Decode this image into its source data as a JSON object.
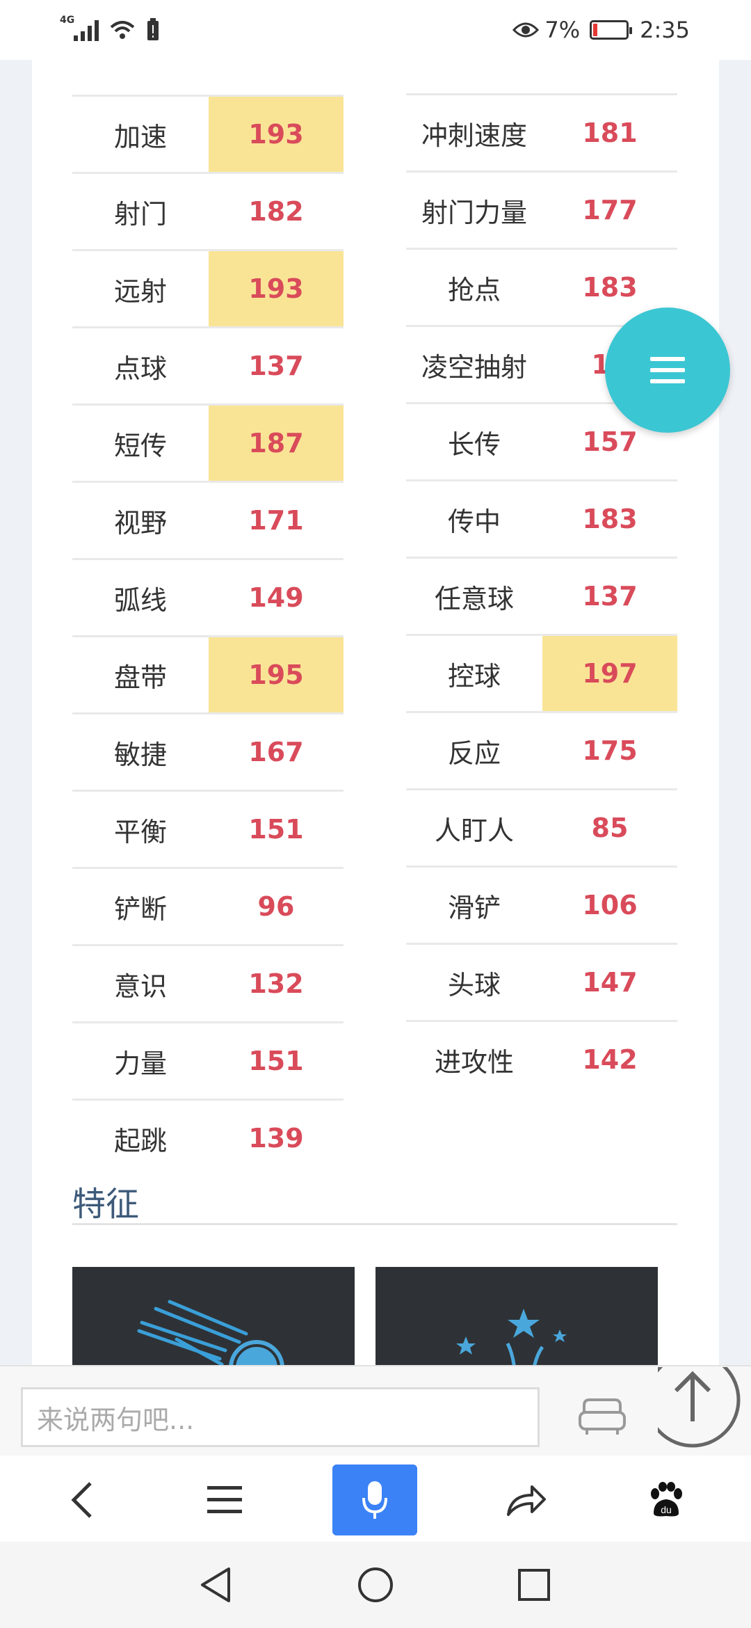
{
  "status_bar": {
    "network": "4G",
    "battery_percent": "7%",
    "time": "2:35"
  },
  "stats_left": [
    {
      "name": "加速",
      "value": "193",
      "highlight": true
    },
    {
      "name": "射门",
      "value": "182",
      "highlight": false
    },
    {
      "name": "远射",
      "value": "193",
      "highlight": true
    },
    {
      "name": "点球",
      "value": "137",
      "highlight": false
    },
    {
      "name": "短传",
      "value": "187",
      "highlight": true
    },
    {
      "name": "视野",
      "value": "171",
      "highlight": false
    },
    {
      "name": "弧线",
      "value": "149",
      "highlight": false
    },
    {
      "name": "盘带",
      "value": "195",
      "highlight": true
    },
    {
      "name": "敏捷",
      "value": "167",
      "highlight": false
    },
    {
      "name": "平衡",
      "value": "151",
      "highlight": false
    },
    {
      "name": "铲断",
      "value": "96",
      "highlight": false
    },
    {
      "name": "意识",
      "value": "132",
      "highlight": false
    },
    {
      "name": "力量",
      "value": "151",
      "highlight": false
    },
    {
      "name": "起跳",
      "value": "139",
      "highlight": false
    }
  ],
  "stats_right": [
    {
      "name": "冲刺速度",
      "value": "181",
      "highlight": false
    },
    {
      "name": "射门力量",
      "value": "177",
      "highlight": false
    },
    {
      "name": "抢点",
      "value": "183",
      "highlight": false
    },
    {
      "name": "凌空抽射",
      "value": "15",
      "highlight": false
    },
    {
      "name": "长传",
      "value": "157",
      "highlight": false
    },
    {
      "name": "传中",
      "value": "183",
      "highlight": false
    },
    {
      "name": "任意球",
      "value": "137",
      "highlight": false
    },
    {
      "name": "控球",
      "value": "197",
      "highlight": true
    },
    {
      "name": "反应",
      "value": "175",
      "highlight": false
    },
    {
      "name": "人盯人",
      "value": "85",
      "highlight": false
    },
    {
      "name": "滑铲",
      "value": "106",
      "highlight": false
    },
    {
      "name": "头球",
      "value": "147",
      "highlight": false
    },
    {
      "name": "进攻性",
      "value": "142",
      "highlight": false
    }
  ],
  "section": {
    "title": "特征"
  },
  "comment": {
    "placeholder": "来说两句吧..."
  },
  "colors": {
    "accent": "#3bc6d3",
    "value_red": "#d94b5a",
    "highlight": "#f9e496",
    "mic_blue": "#3b82f6"
  },
  "icons": {
    "fab": "menu-icon",
    "comment_sofa": "sofa-icon",
    "scroll_top": "arrow-up-icon",
    "back": "chevron-left-icon",
    "menu": "hamburger-icon",
    "mic": "microphone-icon",
    "share": "share-icon",
    "baidu": "paw-icon"
  }
}
